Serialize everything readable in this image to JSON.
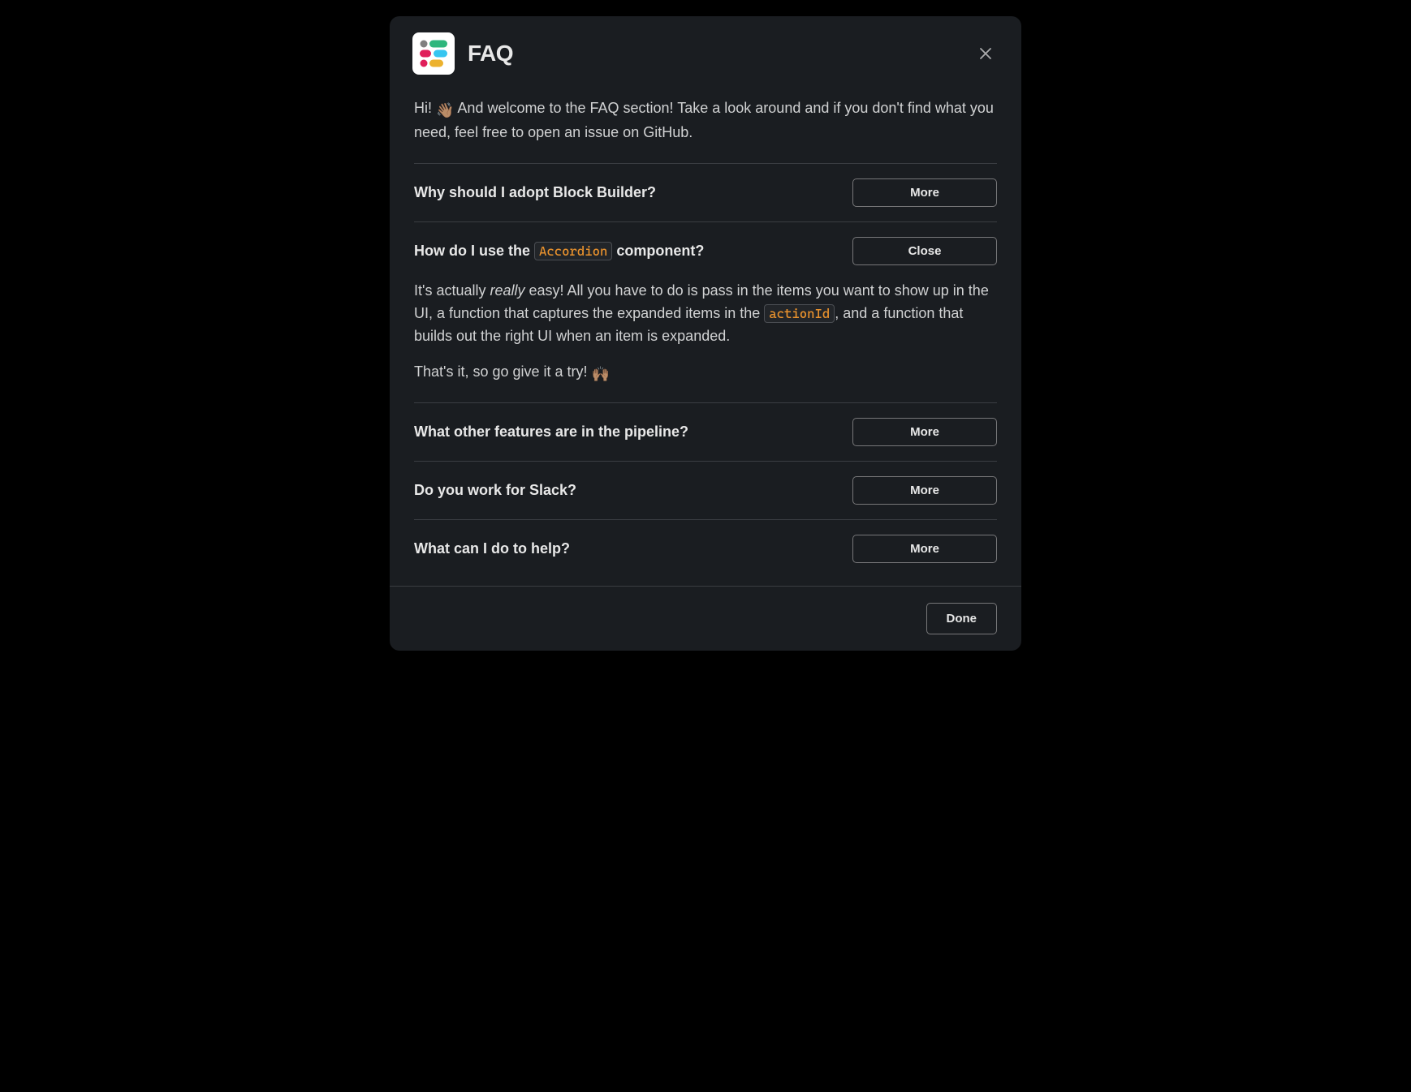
{
  "header": {
    "title": "FAQ"
  },
  "intro": {
    "greeting": "Hi! ",
    "wave_emoji": "👋🏽",
    "text": " And welcome to the FAQ section! Take a look around and if you don't find what you need, feel free to open an issue on GitHub."
  },
  "buttons": {
    "more": "More",
    "close": "Close",
    "done": "Done"
  },
  "faq": [
    {
      "question": "Why should I adopt Block Builder?",
      "action": "more"
    },
    {
      "question_pre": "How do I use the ",
      "question_code": "Accordion",
      "question_post": " component?",
      "action": "close",
      "answer": {
        "p1_pre": "It's actually ",
        "p1_italic": "really",
        "p1_mid": " easy! All you have to do is pass in the items you want to show up in the UI, a function that captures the expanded items in the ",
        "p1_code": "actionId",
        "p1_post": ", and a function that builds out the right UI when an item is expanded.",
        "p2_text": "That's it, so go give it a try!  ",
        "p2_emoji": "🙌🏽"
      }
    },
    {
      "question": "What other features are in the pipeline?",
      "action": "more"
    },
    {
      "question": "Do you work for Slack?",
      "action": "more"
    },
    {
      "question": "What can I do to help?",
      "action": "more"
    }
  ]
}
